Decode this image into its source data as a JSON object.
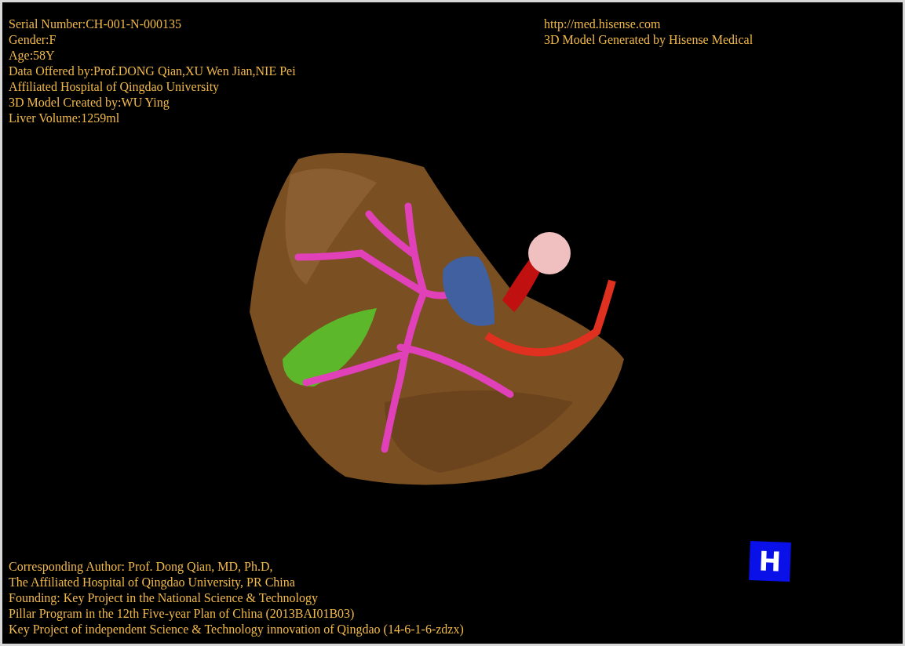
{
  "header_left": [
    "Serial Number:CH-001-N-000135",
    "Gender:F",
    "Age:58Y",
    "Data Offered by:Prof.DONG Qian,XU Wen Jian,NIE Pei",
    "Affiliated Hospital of Qingdao University",
    "3D Model Created by:WU Ying",
    "Liver Volume:1259ml"
  ],
  "header_right": [
    "http://med.hisense.com",
    "3D Model Generated by Hisense Medical"
  ],
  "footer": [
    "Corresponding Author: Prof. Dong Qian, MD, Ph.D,",
    "The Affiliated Hospital of Qingdao University, PR China",
    "Founding: Key Project in the National Science & Technology",
    "Pillar Program in the 12th Five-year Plan of China (2013BAI01B03)",
    "Key Project of independent Science & Technology innovation of Qingdao (14-6-1-6-zdzx)"
  ],
  "badge": "H"
}
